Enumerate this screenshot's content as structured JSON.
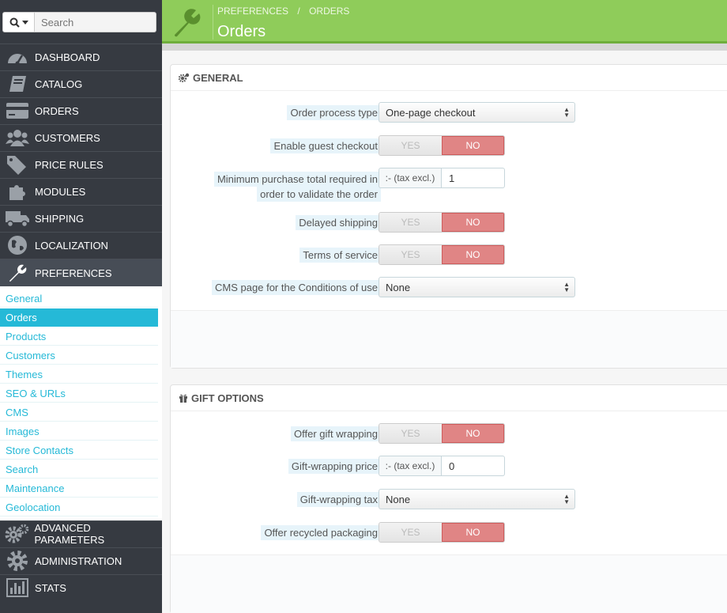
{
  "search": {
    "placeholder": "Search"
  },
  "nav": [
    {
      "label": "DASHBOARD",
      "icon": "dashboard-icon"
    },
    {
      "label": "CATALOG",
      "icon": "book-icon"
    },
    {
      "label": "ORDERS",
      "icon": "credit-card-icon"
    },
    {
      "label": "CUSTOMERS",
      "icon": "users-icon"
    },
    {
      "label": "PRICE RULES",
      "icon": "tags-icon"
    },
    {
      "label": "MODULES",
      "icon": "puzzle-icon"
    },
    {
      "label": "SHIPPING",
      "icon": "truck-icon"
    },
    {
      "label": "LOCALIZATION",
      "icon": "globe-icon"
    },
    {
      "label": "PREFERENCES",
      "icon": "wrench-icon"
    }
  ],
  "submenu": [
    "General",
    "Orders",
    "Products",
    "Customers",
    "Themes",
    "SEO & URLs",
    "CMS",
    "Images",
    "Store Contacts",
    "Search",
    "Maintenance",
    "Geolocation"
  ],
  "nav_bottom": [
    {
      "label": "ADVANCED PARAMETERS",
      "icon": "gears-icon"
    },
    {
      "label": "ADMINISTRATION",
      "icon": "cog-icon"
    },
    {
      "label": "STATS",
      "icon": "bar-chart-icon"
    }
  ],
  "header": {
    "breadcrumb_parent": "PREFERENCES",
    "breadcrumb_sep": "/",
    "breadcrumb_current": "ORDERS",
    "title": "Orders",
    "color": "#8fcc5a"
  },
  "general": {
    "title": "GENERAL",
    "order_process_label": "Order process type",
    "order_process_value": "One-page checkout",
    "guest_checkout_label": "Enable guest checkout",
    "min_purchase_label_1": "Minimum purchase total required in",
    "min_purchase_label_2": "order to validate the order",
    "min_purchase_addon": ":- (tax excl.)",
    "min_purchase_value": "1",
    "delayed_shipping_label": "Delayed shipping",
    "terms_label": "Terms of service",
    "cms_label": "CMS page for the Conditions of use",
    "cms_value": "None"
  },
  "gift": {
    "title": "GIFT OPTIONS",
    "wrapping_label": "Offer gift wrapping",
    "price_label": "Gift-wrapping price",
    "price_addon": ":- (tax excl.)",
    "price_value": "0",
    "tax_label": "Gift-wrapping tax",
    "tax_value": "None",
    "recycled_label": "Offer recycled packaging"
  },
  "switch": {
    "yes": "YES",
    "no": "NO"
  },
  "colors": {
    "accent": "#25b9d7",
    "no_active": "#e08585",
    "sidebar": "#363a41"
  }
}
